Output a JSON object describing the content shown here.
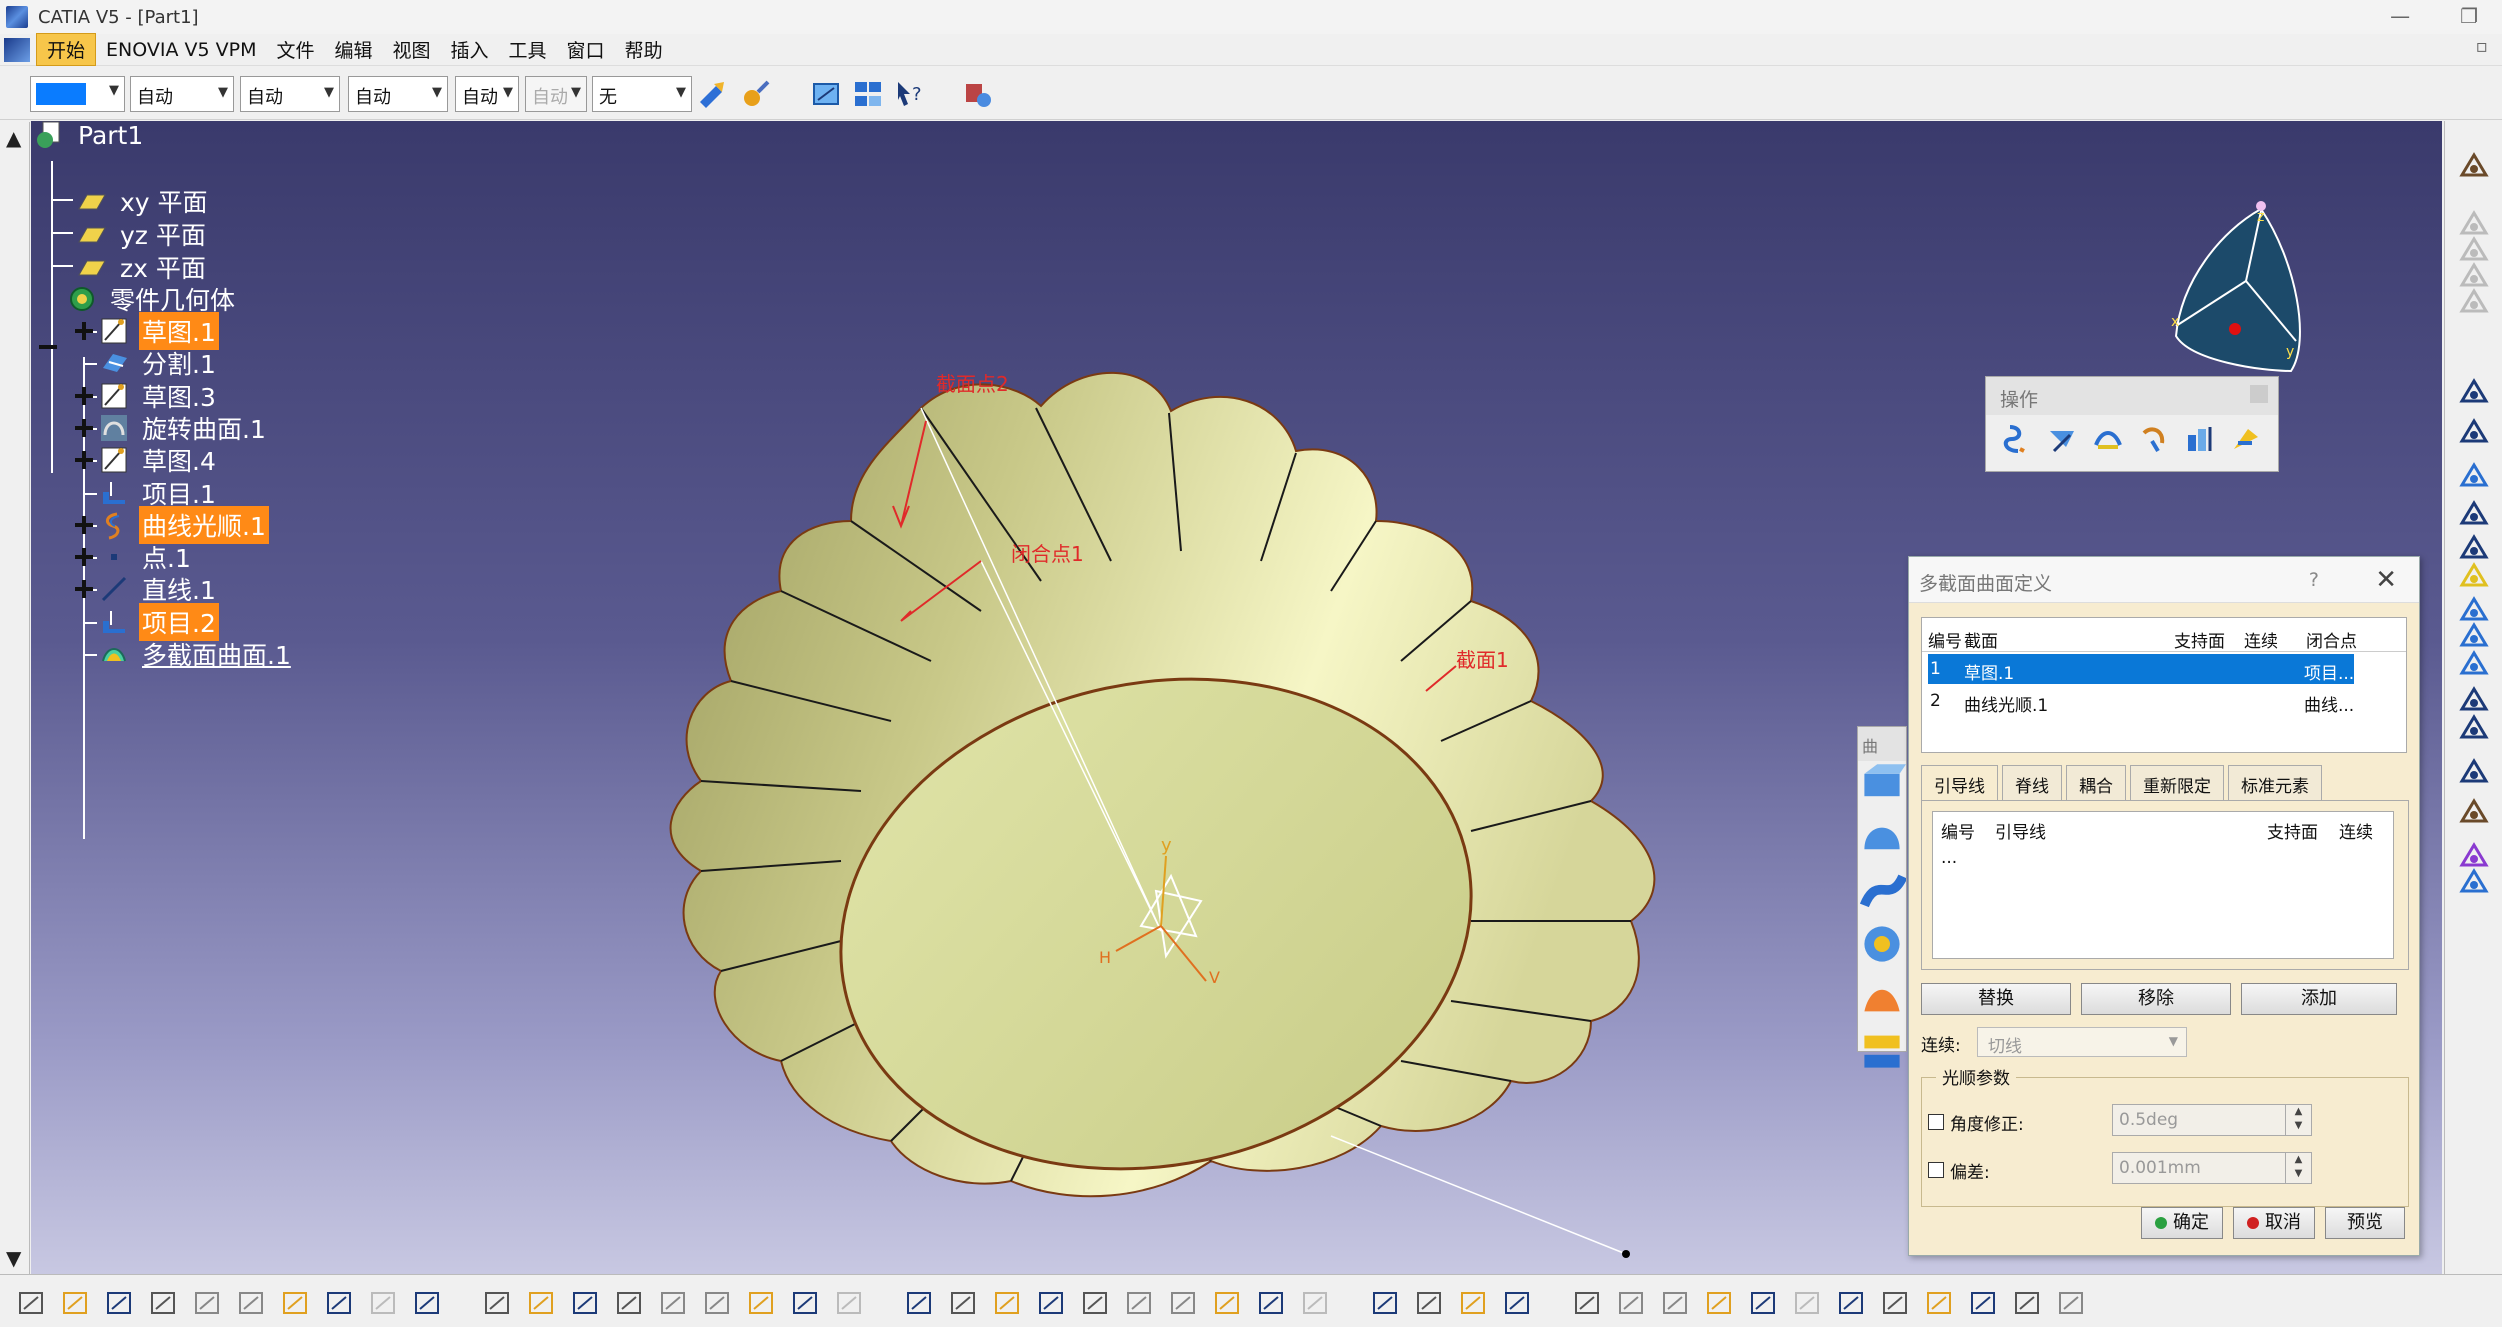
{
  "window": {
    "title": "CATIA V5 - [Part1]",
    "minimize": "—",
    "restore": "❐"
  },
  "menu": [
    "开始",
    "ENOVIA V5 VPM",
    "文件",
    "编辑",
    "视图",
    "插入",
    "工具",
    "窗口",
    "帮助"
  ],
  "toolbar": {
    "color_value": "#0a7cff",
    "selects": [
      "自动",
      "自动",
      "自动",
      "自动",
      "自动",
      "无"
    ]
  },
  "tree": {
    "root": "Part1",
    "planes": [
      "xy 平面",
      "yz 平面",
      "zx 平面"
    ],
    "body": "零件几何体",
    "children": [
      {
        "label": "草图.1",
        "icon": "sketch-icon",
        "highlight": true,
        "expand": true
      },
      {
        "label": "分割.1",
        "icon": "split-icon",
        "highlight": false,
        "expand": false
      },
      {
        "label": "草图.3",
        "icon": "sketch-icon",
        "highlight": false,
        "expand": true
      },
      {
        "label": "旋转曲面.1",
        "icon": "revolve-surface-icon",
        "highlight": false,
        "expand": true
      },
      {
        "label": "草图.4",
        "icon": "sketch-icon",
        "highlight": false,
        "expand": true
      },
      {
        "label": "项目.1",
        "icon": "projection-icon",
        "highlight": false,
        "expand": false
      },
      {
        "label": "曲线光顺.1",
        "icon": "curve-smooth-icon",
        "highlight": true,
        "expand": true
      },
      {
        "label": "点.1",
        "icon": "point-icon",
        "highlight": false,
        "expand": true
      },
      {
        "label": "直线.1",
        "icon": "line-icon",
        "highlight": false,
        "expand": true
      },
      {
        "label": "项目.2",
        "icon": "projection-icon",
        "highlight": true,
        "expand": false
      },
      {
        "label": "多截面曲面.1",
        "icon": "multi-section-surface-icon",
        "highlight": false,
        "expand": false,
        "underline": true
      }
    ]
  },
  "viewport": {
    "annotations": {
      "section_point2": "截面点2",
      "closing_point1": "闭合点1",
      "section1": "截面1"
    },
    "axis_labels": {
      "y": "y",
      "h": "H",
      "v": "V"
    },
    "compass_labels": {
      "z": "z",
      "x": "x",
      "y": "y"
    }
  },
  "ops_toolbar": {
    "title": "操作",
    "icons": [
      "join-icon",
      "heal-icon",
      "untrim-icon",
      "disassemble-icon",
      "split-icon",
      "trim-icon"
    ]
  },
  "side_float": {
    "title": "曲"
  },
  "dialog": {
    "title": "多截面曲面定义",
    "help": "?",
    "close": "✕",
    "sections_table": {
      "headers": [
        "编号",
        "截面",
        "支持面",
        "连续",
        "闭合点"
      ],
      "rows": [
        {
          "num": "1",
          "section": "草图.1",
          "support": "",
          "cont": "",
          "closing": "项目...."
        },
        {
          "num": "2",
          "section": "曲线光顺.1",
          "support": "",
          "cont": "",
          "closing": "曲线..."
        }
      ]
    },
    "tabs": [
      "引导线",
      "脊线",
      "耦合",
      "重新限定",
      "标准元素"
    ],
    "guides_table": {
      "headers": [
        "编号",
        "引导线",
        "支持面",
        "连续"
      ],
      "placeholder": "..."
    },
    "buttons": {
      "replace": "替换",
      "remove": "移除",
      "add": "添加"
    },
    "continuity_label": "连续:",
    "continuity_value": "切线",
    "smoothing": {
      "group_title": "光顺参数",
      "angle_label": "角度修正:",
      "angle_value": "0.5deg",
      "deviation_label": "偏差:",
      "deviation_value": "0.001mm"
    },
    "ok": "确定",
    "cancel": "取消",
    "preview": "预览"
  }
}
